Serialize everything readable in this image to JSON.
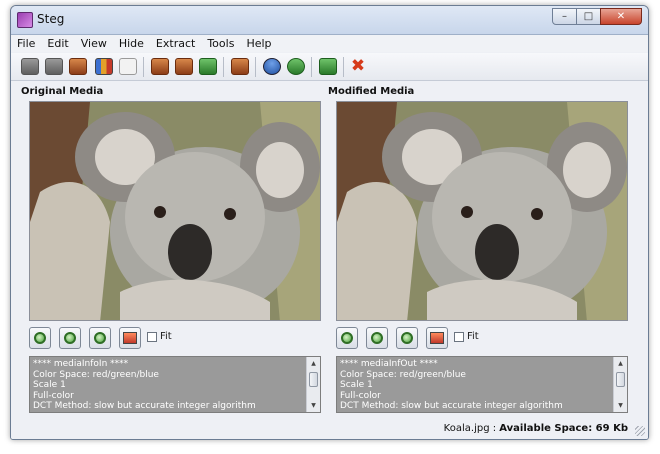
{
  "window": {
    "title": "Steg",
    "controls": [
      "–",
      "□",
      "✕"
    ]
  },
  "menu": [
    "File",
    "Edit",
    "View",
    "Hide",
    "Extract",
    "Tools",
    "Help"
  ],
  "panels": {
    "original": {
      "label": "Original Media",
      "fit_label": "Fit",
      "info_lines": [
        "**** mediaInfoIn ****",
        "Color Space: red/green/blue",
        "Scale 1",
        "Full-color",
        "DCT Method: slow but accurate integer algorithm"
      ]
    },
    "modified": {
      "label": "Modified Media",
      "fit_label": "Fit",
      "info_lines": [
        "**** mediaInfOut ****",
        "Color Space: red/green/blue",
        "Scale 1",
        "Full-color",
        "DCT Method: slow but accurate integer algorithm"
      ]
    }
  },
  "status": {
    "filename": "Koala.jpg",
    "separator": " : ",
    "available": "Available Space: 69 Kb"
  }
}
